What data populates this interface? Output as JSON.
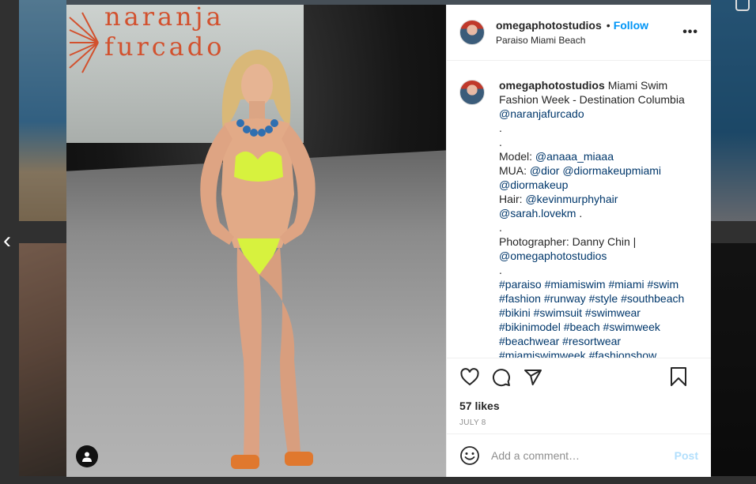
{
  "post": {
    "username": "omegaphotostudios",
    "separator": "•",
    "follow_label": "Follow",
    "location": "Paraiso Miami Beach",
    "more_label": "•••",
    "image": {
      "brand_text": "naranja\nfurcado"
    },
    "caption": {
      "username": "omegaphotostudios",
      "lines": [
        {
          "text": "Miami Swim",
          "type": "text"
        },
        {
          "text": "Fashion Week - Destination Columbia",
          "type": "text"
        },
        {
          "text": "@naranjafurcado",
          "type": "mention"
        },
        {
          "text": ".",
          "type": "text"
        },
        {
          "text": ".",
          "type": "text"
        },
        {
          "text": "Model: ",
          "type": "text",
          "mention": "@anaaa_miaaa"
        },
        {
          "text": "MUA: ",
          "type": "text",
          "mention": "@dior @diormakeupmiami"
        },
        {
          "text": "",
          "type": "mention",
          "mention": "@diormakeup"
        },
        {
          "text": "Hair: ",
          "type": "text",
          "mention": "@kevinmurphyhair"
        },
        {
          "text": " .",
          "type": "text",
          "mention_before": "@sarah.lovekm"
        },
        {
          "text": ".",
          "type": "text"
        },
        {
          "text": "Photographer: Danny Chin |",
          "type": "text"
        },
        {
          "text": "@omegaphotostudios",
          "type": "mention"
        },
        {
          "text": ".",
          "type": "text"
        },
        {
          "text": "#paraiso #miamiswim #miami #swim",
          "type": "mention"
        },
        {
          "text": "#fashion #runway #style #southbeach",
          "type": "mention"
        },
        {
          "text": "#bikini #swimsuit #swimwear",
          "type": "mention"
        },
        {
          "text": "#bikinimodel #beach #swimweek",
          "type": "mention"
        },
        {
          "text": "#beachwear #resortwear",
          "type": "mention"
        },
        {
          "text": "#miamiswimweek #fashionshow",
          "type": "mention"
        }
      ]
    },
    "likes": "57 likes",
    "date": "JULY 8",
    "comment": {
      "placeholder": "Add a comment…",
      "value": "",
      "post_label": "Post"
    }
  },
  "nav": {
    "prev_label": "‹"
  },
  "icons": {
    "like": "heart-icon",
    "comment": "comment-icon",
    "share": "paper-plane-icon",
    "save": "bookmark-icon",
    "emoji": "smiley-icon",
    "more": "more-options-icon",
    "profile_chip": "user-icon"
  },
  "colors": {
    "link": "#0095f6",
    "mention": "#00376b",
    "post_disabled": "#b2dffc",
    "brand_orange": "#d2512e",
    "bikini": "#d7f23e",
    "necklace": "#2f6fb0"
  }
}
